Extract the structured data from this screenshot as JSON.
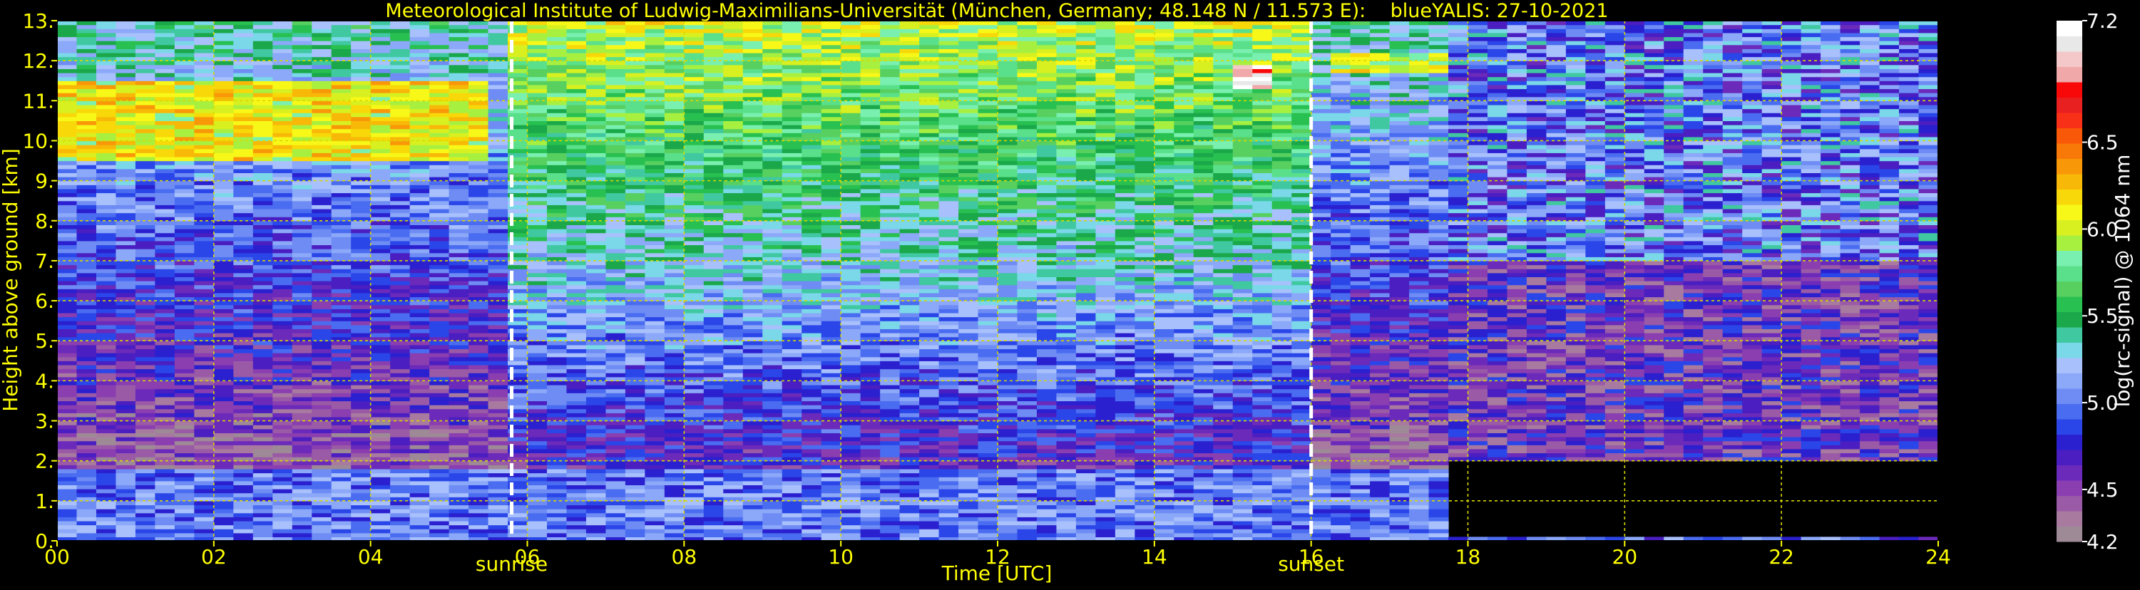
{
  "chart_data": {
    "type": "heatmap",
    "title": "Meteorological Institute of Ludwig-Maximilians-Universität (München, Germany; 48.148 N / 11.573 E):    blueYALIS: 27-10-2021",
    "xlabel": "Time [UTC]",
    "ylabel": "Height above ground [km]",
    "xlim": [
      0,
      24
    ],
    "ylim": [
      0,
      13
    ],
    "x_ticks": [
      0,
      2,
      4,
      6,
      8,
      10,
      12,
      14,
      16,
      18,
      20,
      22,
      24
    ],
    "x_tick_labels": [
      "00",
      "02",
      "04",
      "06",
      "08",
      "10",
      "12",
      "14",
      "16",
      "18",
      "20",
      "22",
      "24"
    ],
    "y_ticks": [
      0,
      1,
      2,
      3,
      4,
      5,
      6,
      7,
      8,
      9,
      10,
      11,
      12,
      13
    ],
    "y_tick_labels": [
      "0.",
      "1.",
      "2.",
      "3.",
      "4.",
      "5.",
      "6.",
      "7.",
      "8.",
      "9.",
      "10.",
      "11.",
      "12.",
      "13."
    ],
    "grid": true,
    "markers": [
      {
        "x": 5.8,
        "label": "sunrise"
      },
      {
        "x": 16.0,
        "label": "sunset"
      }
    ],
    "colorbar": {
      "label": "log(rc-signal) @ 1064 nm",
      "range": [
        4.2,
        7.2
      ],
      "ticks": [
        4.2,
        4.5,
        5.0,
        5.5,
        6.0,
        6.5,
        7.2
      ],
      "tick_labels": [
        "4.2",
        "4.5",
        "5.0",
        "5.5",
        "6.0",
        "6.5",
        "7.2"
      ],
      "colors": [
        "#9e8a96",
        "#a87aa0",
        "#9a5aa6",
        "#8a3eb0",
        "#6b2aba",
        "#4a1ec0",
        "#2a20d0",
        "#2a46e8",
        "#4a6cf0",
        "#6e8cf4",
        "#8ca8f8",
        "#a8c0fc",
        "#7ad8e8",
        "#40c8a0",
        "#1aa84a",
        "#28c050",
        "#58d060",
        "#5ae08a",
        "#7af0b0",
        "#a8f040",
        "#d8f020",
        "#f8f818",
        "#f8d808",
        "#f8b808",
        "#f89808",
        "#f87808",
        "#f85808",
        "#f83018",
        "#e82020",
        "#f80808",
        "#f0a8a8",
        "#f4c8c8",
        "#e8e8e8",
        "#ffffff"
      ]
    },
    "field": {
      "time_bins": 96,
      "height_bins": 130,
      "features": [
        {
          "kind": "boundary layer",
          "x": [
            0,
            17.8
          ],
          "y": [
            0,
            1.8
          ],
          "value": 5.0
        },
        {
          "kind": "cirrus cloud",
          "x": [
            0,
            5.5
          ],
          "y": [
            9.5,
            11.5
          ],
          "value": 6.1
        },
        {
          "kind": "cirrus cloud",
          "x": [
            16.2,
            17.8
          ],
          "y": [
            11.7,
            12.2
          ],
          "value": 6.0
        },
        {
          "kind": "cloud",
          "x": [
            14.9,
            15.4
          ],
          "y": [
            11.3,
            11.9
          ],
          "value": 7.0
        }
      ]
    }
  }
}
